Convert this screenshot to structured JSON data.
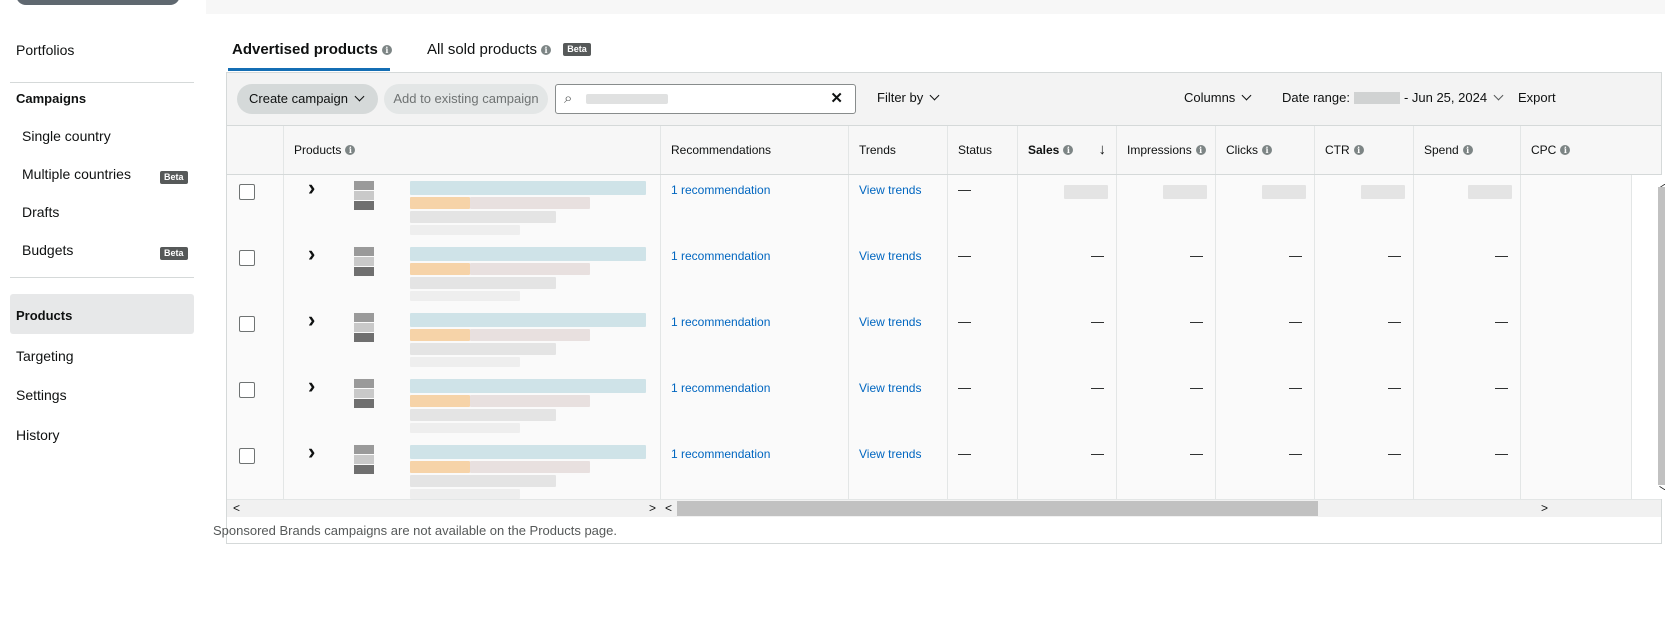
{
  "sidebar": {
    "items": [
      {
        "label": "Portfolios"
      },
      {
        "label": "Campaigns"
      },
      {
        "label": "Single country"
      },
      {
        "label": "Multiple countries",
        "badge": "Beta"
      },
      {
        "label": "Drafts"
      },
      {
        "label": "Budgets",
        "badge": "Beta"
      },
      {
        "label": "Products"
      },
      {
        "label": "Targeting"
      },
      {
        "label": "Settings"
      },
      {
        "label": "History"
      }
    ]
  },
  "tabs": {
    "advertised": {
      "label": "Advertised products"
    },
    "all_sold": {
      "label": "All sold products",
      "badge": "Beta"
    }
  },
  "toolbar": {
    "create_campaign": "Create campaign",
    "add_existing": "Add to existing campaign",
    "search_placeholder": "",
    "filter_by": "Filter by",
    "columns": "Columns",
    "date_range_label": "Date range:",
    "date_range_end": "- Jun 25, 2024",
    "export": "Export"
  },
  "table": {
    "headers": {
      "products": "Products",
      "recommendations": "Recommendations",
      "trends": "Trends",
      "status": "Status",
      "sales": "Sales",
      "impressions": "Impressions",
      "clicks": "Clicks",
      "ctr": "CTR",
      "spend": "Spend",
      "cpc": "CPC"
    },
    "rows": [
      {
        "recommendation": "1 recommendation",
        "trends": "View trends",
        "status": "—",
        "sales": "",
        "impressions": "",
        "clicks": "",
        "ctr": "",
        "spend": ""
      },
      {
        "recommendation": "1 recommendation",
        "trends": "View trends",
        "status": "—",
        "sales": "—",
        "impressions": "—",
        "clicks": "—",
        "ctr": "—",
        "spend": "—"
      },
      {
        "recommendation": "1 recommendation",
        "trends": "View trends",
        "status": "—",
        "sales": "—",
        "impressions": "—",
        "clicks": "—",
        "ctr": "—",
        "spend": "—"
      },
      {
        "recommendation": "1 recommendation",
        "trends": "View trends",
        "status": "—",
        "sales": "—",
        "impressions": "—",
        "clicks": "—",
        "ctr": "—",
        "spend": "—"
      },
      {
        "recommendation": "1 recommendation",
        "trends": "View trends",
        "status": "—",
        "sales": "—",
        "impressions": "—",
        "clicks": "—",
        "ctr": "—",
        "spend": "—"
      }
    ]
  },
  "footnote": "Sponsored Brands campaigns are not available on the Products page.",
  "colors": {
    "accent": "#146eb4",
    "link": "#0066c0"
  }
}
